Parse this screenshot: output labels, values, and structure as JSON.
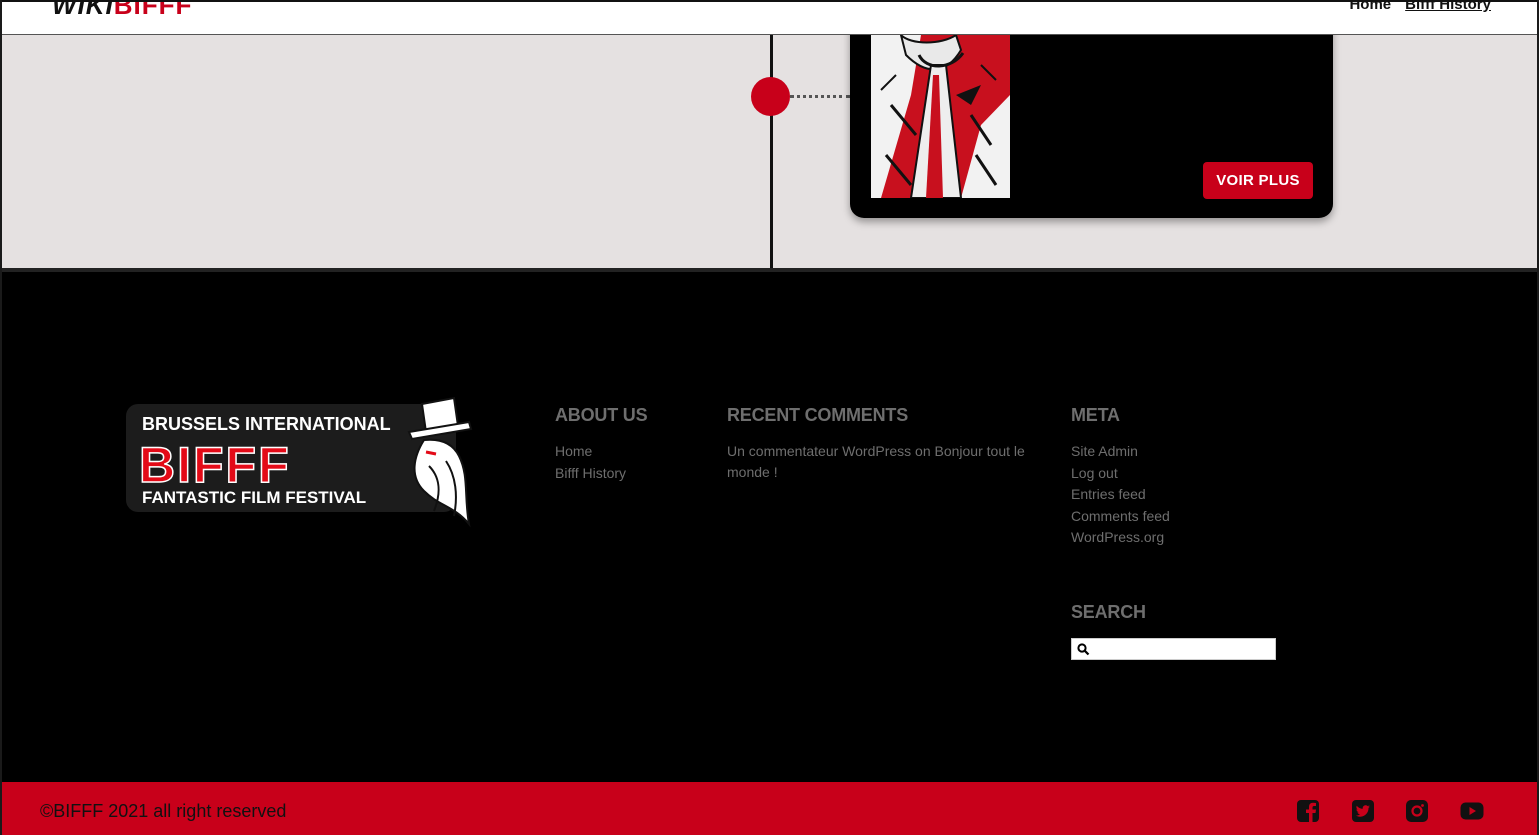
{
  "header": {
    "logo_wiki": "WIKI",
    "logo_bifff": "BIFFF",
    "nav": [
      {
        "label": "Home"
      },
      {
        "label": "Bifff History"
      }
    ]
  },
  "timeline": {
    "button_label": "VOIR PLUS"
  },
  "footer": {
    "logo": {
      "line1": "BRUSSELS INTERNATIONAL",
      "line2": "BIFFF",
      "line3": "FANTASTIC FILM FESTIVAL"
    },
    "about": {
      "title": "ABOUT US",
      "links": [
        "Home",
        "Bifff History"
      ]
    },
    "recent_comments": {
      "title": "RECENT COMMENTS",
      "author": "Un commentateur WordPress",
      "connector": "on",
      "post": "Bonjour tout le monde !"
    },
    "meta": {
      "title": "META",
      "links": [
        "Site Admin",
        "Log out",
        "Entries feed",
        "Comments feed",
        "WordPress.org"
      ]
    },
    "search": {
      "title": "SEARCH",
      "value": ""
    }
  },
  "bottom_bar": {
    "copyright": "©BIFFF 2021 all right reserved",
    "social_icons": [
      "facebook-icon",
      "twitter-icon",
      "instagram-icon",
      "youtube-icon"
    ]
  },
  "colors": {
    "brand_red": "#c8001a",
    "timeline_bg": "#e5e1e1",
    "footer_text": "#6e6e6e"
  }
}
